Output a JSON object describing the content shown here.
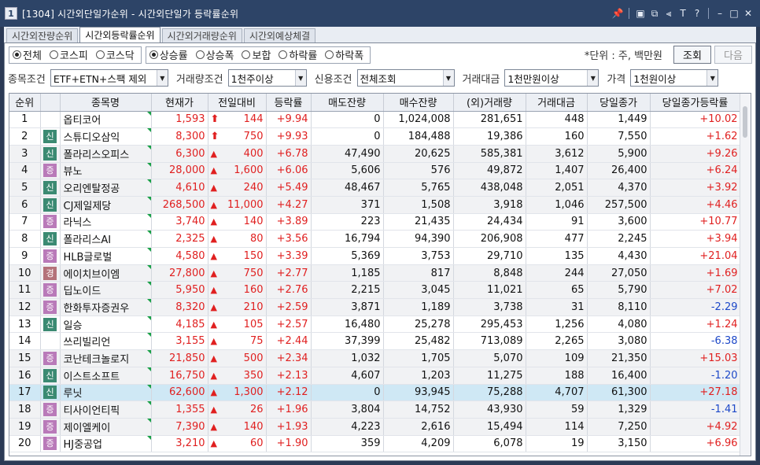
{
  "window": {
    "icon": "1",
    "title": "[1304] 시간외단일가순위 - 시간외단일가 등락률순위",
    "controls": [
      "pin-icon",
      "window-icon",
      "restore-icon",
      "refresh-icon",
      "font-icon",
      "help-icon",
      "minimize-icon",
      "maximize-icon",
      "close-icon"
    ],
    "control_glyphs": [
      "📌",
      "▣",
      "⧉",
      "⫷",
      "T",
      "?",
      "–",
      "□",
      "✕"
    ]
  },
  "tabs": [
    {
      "label": "시간외잔량순위",
      "active": false
    },
    {
      "label": "시간외등락률순위",
      "active": true
    },
    {
      "label": "시간외거래량순위",
      "active": false
    },
    {
      "label": "시간외예상체결",
      "active": false
    }
  ],
  "market_filter": [
    {
      "label": "전체",
      "selected": true
    },
    {
      "label": "코스피",
      "selected": false
    },
    {
      "label": "코스닥",
      "selected": false
    }
  ],
  "change_filter": [
    {
      "label": "상승률",
      "selected": true
    },
    {
      "label": "상승폭",
      "selected": false
    },
    {
      "label": "보합",
      "selected": false
    },
    {
      "label": "하락률",
      "selected": false
    },
    {
      "label": "하락폭",
      "selected": false
    }
  ],
  "unit_label": "*단위 : 주, 백만원",
  "buttons": {
    "query": "조회",
    "next": "다음"
  },
  "conditions": [
    {
      "label": "종목조건",
      "value": "ETF+ETN+스팩 제외"
    },
    {
      "label": "거래량조건",
      "value": "1천주이상"
    },
    {
      "label": "신용조건",
      "value": "전체조회"
    },
    {
      "label": "거래대금",
      "value": "1천만원이상"
    },
    {
      "label": "가격",
      "value": "1천원이상"
    }
  ],
  "columns": [
    "순위",
    "",
    "종목명",
    "현재가",
    "전일대비",
    "등락률",
    "매도잔량",
    "매수잔량",
    "(외)거래량",
    "거래대금",
    "당일종가",
    "당일종가등락률"
  ],
  "rows": [
    {
      "rank": "1",
      "badge": "",
      "name": "옵티코어",
      "price": "1,593",
      "diff": "144",
      "rate": "+9.94",
      "ask": "0",
      "bid": "1,024,008",
      "volume": "281,651",
      "amount": "448",
      "close": "1,449",
      "close_rate": "+10.02"
    },
    {
      "rank": "2",
      "badge": "신",
      "name": "스튜디오삼익",
      "price": "8,300",
      "diff": "750",
      "rate": "+9.93",
      "ask": "0",
      "bid": "184,488",
      "volume": "19,386",
      "amount": "160",
      "close": "7,550",
      "close_rate": "+1.62"
    },
    {
      "rank": "3",
      "badge": "신",
      "name": "폴라리스오피스",
      "price": "6,300",
      "diff": "400",
      "rate": "+6.78",
      "ask": "47,490",
      "bid": "20,625",
      "volume": "585,381",
      "amount": "3,612",
      "close": "5,900",
      "close_rate": "+9.26"
    },
    {
      "rank": "4",
      "badge": "증",
      "name": "뷰노",
      "price": "28,000",
      "diff": "1,600",
      "rate": "+6.06",
      "ask": "5,606",
      "bid": "576",
      "volume": "49,872",
      "amount": "1,407",
      "close": "26,400",
      "close_rate": "+6.24"
    },
    {
      "rank": "5",
      "badge": "신",
      "name": "오리엔탈정공",
      "price": "4,610",
      "diff": "240",
      "rate": "+5.49",
      "ask": "48,467",
      "bid": "5,765",
      "volume": "438,048",
      "amount": "2,051",
      "close": "4,370",
      "close_rate": "+3.92"
    },
    {
      "rank": "6",
      "badge": "신",
      "name": "CJ제일제당",
      "price": "268,500",
      "diff": "11,000",
      "rate": "+4.27",
      "ask": "371",
      "bid": "1,508",
      "volume": "3,918",
      "amount": "1,046",
      "close": "257,500",
      "close_rate": "+4.46"
    },
    {
      "rank": "7",
      "badge": "증",
      "name": "라닉스",
      "price": "3,740",
      "diff": "140",
      "rate": "+3.89",
      "ask": "223",
      "bid": "21,435",
      "volume": "24,434",
      "amount": "91",
      "close": "3,600",
      "close_rate": "+10.77"
    },
    {
      "rank": "8",
      "badge": "신",
      "name": "폴라리스AI",
      "price": "2,325",
      "diff": "80",
      "rate": "+3.56",
      "ask": "16,794",
      "bid": "94,390",
      "volume": "206,908",
      "amount": "477",
      "close": "2,245",
      "close_rate": "+3.94"
    },
    {
      "rank": "9",
      "badge": "증",
      "name": "HLB글로벌",
      "price": "4,580",
      "diff": "150",
      "rate": "+3.39",
      "ask": "5,369",
      "bid": "3,753",
      "volume": "29,710",
      "amount": "135",
      "close": "4,430",
      "close_rate": "+21.04"
    },
    {
      "rank": "10",
      "badge": "경",
      "name": "에이치브이엠",
      "price": "27,800",
      "diff": "750",
      "rate": "+2.77",
      "ask": "1,185",
      "bid": "817",
      "volume": "8,848",
      "amount": "244",
      "close": "27,050",
      "close_rate": "+1.69"
    },
    {
      "rank": "11",
      "badge": "증",
      "name": "딥노이드",
      "price": "5,950",
      "diff": "160",
      "rate": "+2.76",
      "ask": "2,215",
      "bid": "3,045",
      "volume": "11,021",
      "amount": "65",
      "close": "5,790",
      "close_rate": "+7.02"
    },
    {
      "rank": "12",
      "badge": "증",
      "name": "한화투자증권우",
      "price": "8,320",
      "diff": "210",
      "rate": "+2.59",
      "ask": "3,871",
      "bid": "1,189",
      "volume": "3,738",
      "amount": "31",
      "close": "8,110",
      "close_rate": "-2.29"
    },
    {
      "rank": "13",
      "badge": "신",
      "name": "일승",
      "price": "4,185",
      "diff": "105",
      "rate": "+2.57",
      "ask": "16,480",
      "bid": "25,278",
      "volume": "295,453",
      "amount": "1,256",
      "close": "4,080",
      "close_rate": "+1.24"
    },
    {
      "rank": "14",
      "badge": "",
      "name": "쓰리빌리언",
      "price": "3,155",
      "diff": "75",
      "rate": "+2.44",
      "ask": "37,399",
      "bid": "25,482",
      "volume": "713,089",
      "amount": "2,265",
      "close": "3,080",
      "close_rate": "-6.38"
    },
    {
      "rank": "15",
      "badge": "증",
      "name": "코난테크놀로지",
      "price": "21,850",
      "diff": "500",
      "rate": "+2.34",
      "ask": "1,032",
      "bid": "1,705",
      "volume": "5,070",
      "amount": "109",
      "close": "21,350",
      "close_rate": "+15.03"
    },
    {
      "rank": "16",
      "badge": "신",
      "name": "이스트소프트",
      "price": "16,750",
      "diff": "350",
      "rate": "+2.13",
      "ask": "4,607",
      "bid": "1,203",
      "volume": "11,275",
      "amount": "188",
      "close": "16,400",
      "close_rate": "-1.20"
    },
    {
      "rank": "17",
      "badge": "신",
      "name": "루닛",
      "price": "62,600",
      "diff": "1,300",
      "rate": "+2.12",
      "ask": "0",
      "bid": "93,945",
      "volume": "75,288",
      "amount": "4,707",
      "close": "61,300",
      "close_rate": "+27.18"
    },
    {
      "rank": "18",
      "badge": "증",
      "name": "티사이언티픽",
      "price": "1,355",
      "diff": "26",
      "rate": "+1.96",
      "ask": "3,804",
      "bid": "14,752",
      "volume": "43,930",
      "amount": "59",
      "close": "1,329",
      "close_rate": "-1.41"
    },
    {
      "rank": "19",
      "badge": "증",
      "name": "제이엘케이",
      "price": "7,390",
      "diff": "140",
      "rate": "+1.93",
      "ask": "4,223",
      "bid": "2,616",
      "volume": "15,494",
      "amount": "114",
      "close": "7,250",
      "close_rate": "+4.92"
    },
    {
      "rank": "20",
      "badge": "증",
      "name": "HJ중공업",
      "price": "3,210",
      "diff": "60",
      "rate": "+1.90",
      "ask": "359",
      "bid": "4,209",
      "volume": "6,078",
      "amount": "19",
      "close": "3,150",
      "close_rate": "+6.96"
    }
  ],
  "selected_rank": "17",
  "colors": {
    "up": "#e02020",
    "down": "#1d48c8",
    "title_bar": "#2d4467",
    "selected_row": "#cfe8f5"
  }
}
